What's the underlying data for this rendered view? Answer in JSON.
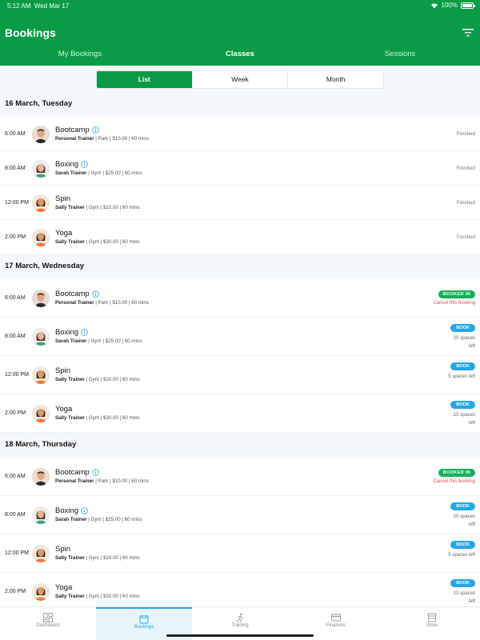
{
  "status_bar": {
    "time": "5:12 AM",
    "date": "Wed Mar 17",
    "battery": "100%"
  },
  "header": {
    "title": "Bookings"
  },
  "tabs": [
    {
      "label": "My Bookings",
      "active": false
    },
    {
      "label": "Classes",
      "active": true
    },
    {
      "label": "Sessions",
      "active": false
    }
  ],
  "view_toggle": [
    {
      "label": "List",
      "active": true
    },
    {
      "label": "Week",
      "active": false
    },
    {
      "label": "Month",
      "active": false
    }
  ],
  "days": [
    {
      "title": "16 March, Tuesday",
      "classes": [
        {
          "time": "6:00 AM",
          "name": "Bootcamp",
          "info": true,
          "trainer": "Personal Trainer",
          "details": " | Park | $10.00 | 60 mins",
          "status": "finished",
          "status_text": "Finished",
          "avatar": "male-trainer"
        },
        {
          "time": "8:00 AM",
          "name": "Boxing",
          "info": true,
          "trainer": "Sarah Trainer",
          "details": " | Gym | $25.00 | 60 mins",
          "status": "finished",
          "status_text": "Finished",
          "avatar": "female-trainer-gray"
        },
        {
          "time": "12:00 PM",
          "name": "Spin",
          "info": false,
          "trainer": "Sally Trainer",
          "details": " | Gym | $10.00 | 60 mins",
          "status": "finished",
          "status_text": "Finished",
          "avatar": "female-trainer-orange"
        },
        {
          "time": "2:00 PM",
          "name": "Yoga",
          "info": false,
          "trainer": "Sally Trainer",
          "details": " | Gym | $30.00 | 60 mins",
          "status": "finished",
          "status_text": "Finished",
          "avatar": "female-trainer-orange"
        }
      ]
    },
    {
      "title": "17 March, Wednesday",
      "classes": [
        {
          "time": "6:00 AM",
          "name": "Bootcamp",
          "info": true,
          "trainer": "Personal Trainer",
          "details": " | Park | $10.00 | 60 mins",
          "status": "booked",
          "status_text": "BOOKED IN",
          "cancel_text": "Cancel this booking",
          "avatar": "male-trainer"
        },
        {
          "time": "8:00 AM",
          "name": "Boxing",
          "info": true,
          "trainer": "Sarah Trainer",
          "details": " | Gym | $25.00 | 60 mins",
          "status": "book",
          "status_text": "BOOK",
          "spaces_text": "20 spaces left",
          "avatar": "female-trainer-gray"
        },
        {
          "time": "12:00 PM",
          "name": "Spin",
          "info": false,
          "trainer": "Sally Trainer",
          "details": " | Gym | $10.00 | 60 mins",
          "status": "book",
          "status_text": "BOOK",
          "spaces_text": "5 spaces left",
          "avatar": "female-trainer-orange"
        },
        {
          "time": "2:00 PM",
          "name": "Yoga",
          "info": false,
          "trainer": "Sally Trainer",
          "details": " | Gym | $30.00 | 60 mins",
          "status": "book",
          "status_text": "BOOK",
          "spaces_text": "13 spaces left",
          "avatar": "female-trainer-orange"
        }
      ]
    },
    {
      "title": "18 March, Thursday",
      "classes": [
        {
          "time": "6:00 AM",
          "name": "Bootcamp",
          "info": true,
          "trainer": "Personal Trainer",
          "details": " | Park | $10.00 | 60 mins",
          "status": "booked",
          "status_text": "BOOKED IN",
          "cancel_text": "Cancel this booking",
          "avatar": "male-trainer"
        },
        {
          "time": "8:00 AM",
          "name": "Boxing",
          "info": true,
          "trainer": "Sarah Trainer",
          "details": " | Gym | $25.00 | 60 mins",
          "status": "book",
          "status_text": "BOOK",
          "spaces_text": "20 spaces left",
          "avatar": "female-trainer-gray"
        },
        {
          "time": "12:00 PM",
          "name": "Spin",
          "info": false,
          "trainer": "Sally Trainer",
          "details": " | Gym | $10.00 | 60 mins",
          "status": "book",
          "status_text": "BOOK",
          "spaces_text": "5 spaces left",
          "avatar": "female-trainer-orange"
        },
        {
          "time": "2:00 PM",
          "name": "Yoga",
          "info": false,
          "trainer": "Sally Trainer",
          "details": " | Gym | $30.00 | 60 mins",
          "status": "book",
          "status_text": "BOOK",
          "spaces_text": "13 spaces left",
          "avatar": "female-trainer-orange"
        }
      ]
    }
  ],
  "bottom_nav": [
    {
      "label": "Dashboard",
      "icon": "dashboard-icon",
      "active": false
    },
    {
      "label": "Bookings",
      "icon": "calendar-icon",
      "active": true
    },
    {
      "label": "Training",
      "icon": "running-icon",
      "active": false
    },
    {
      "label": "Finances",
      "icon": "card-icon",
      "active": false
    },
    {
      "label": "Store",
      "icon": "store-icon",
      "active": false
    }
  ],
  "colors": {
    "brand_green": "#0a9b46",
    "booked_green": "#14b05a",
    "book_blue": "#25a7e6",
    "cancel_red": "#e05050"
  }
}
